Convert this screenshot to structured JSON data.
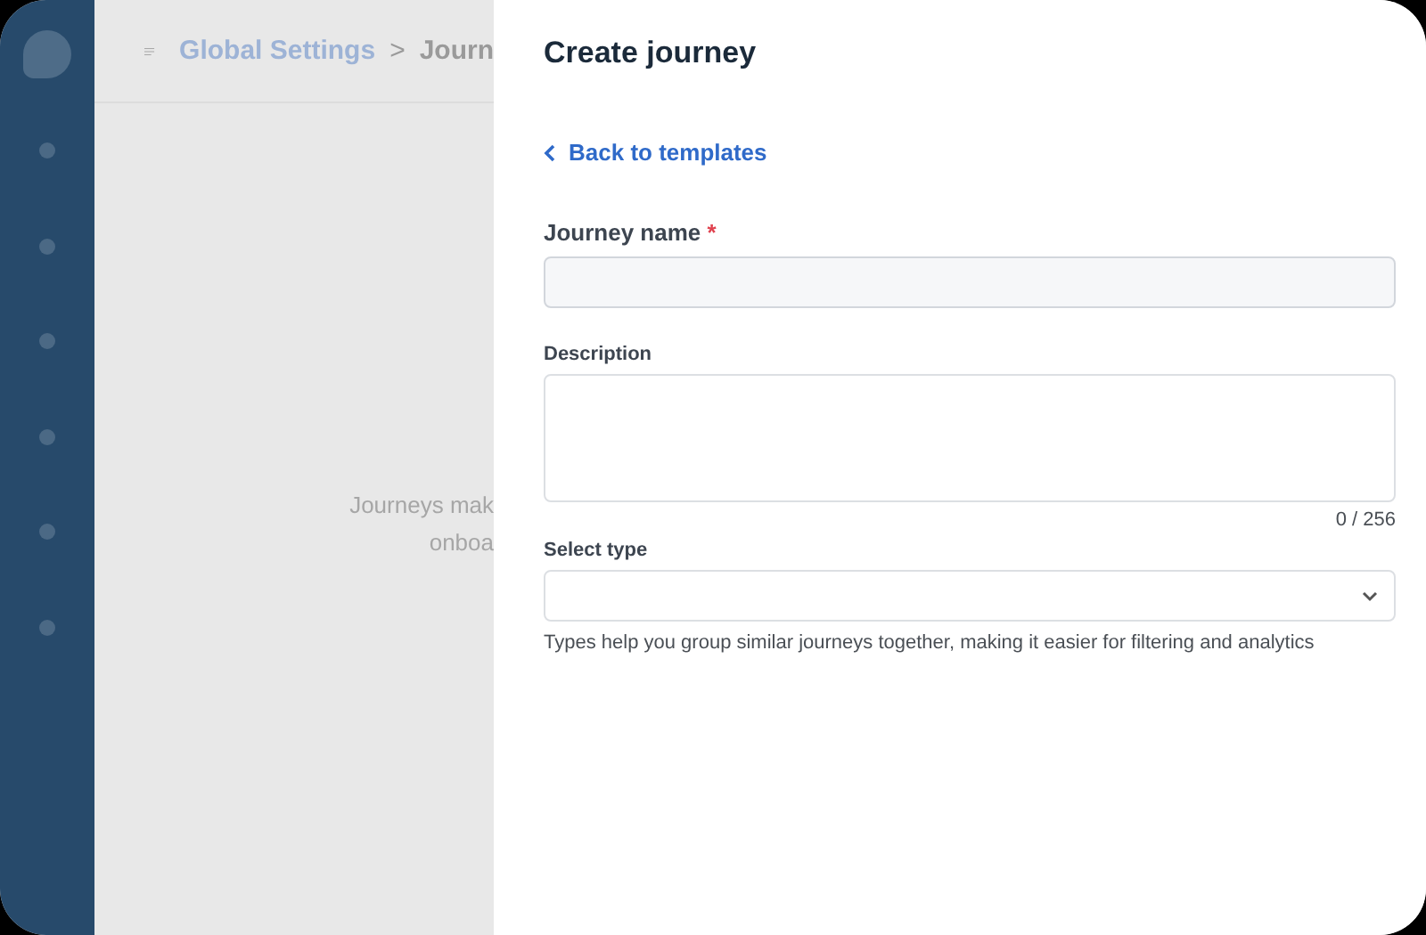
{
  "sidebar": {
    "items": [
      {
        "selected": false
      },
      {
        "selected": false
      },
      {
        "selected": false
      },
      {
        "selected": false
      },
      {
        "selected": false
      },
      {
        "selected": false
      }
    ]
  },
  "header": {
    "breadcrumb": [
      "Global Settings",
      "Journ"
    ],
    "separator": ">"
  },
  "background_text": [
    "Journeys mak",
    "onboa"
  ],
  "drawer": {
    "title": "Create journey",
    "back_link": "Back to templates",
    "journey_name": {
      "label": "Journey name",
      "required_mark": "*"
    },
    "description": {
      "label": "Description",
      "counter": "0 / 256"
    },
    "type": {
      "label": "Select type",
      "help": "Types help you group similar journeys together, making it easier for filtering and analytics"
    }
  }
}
